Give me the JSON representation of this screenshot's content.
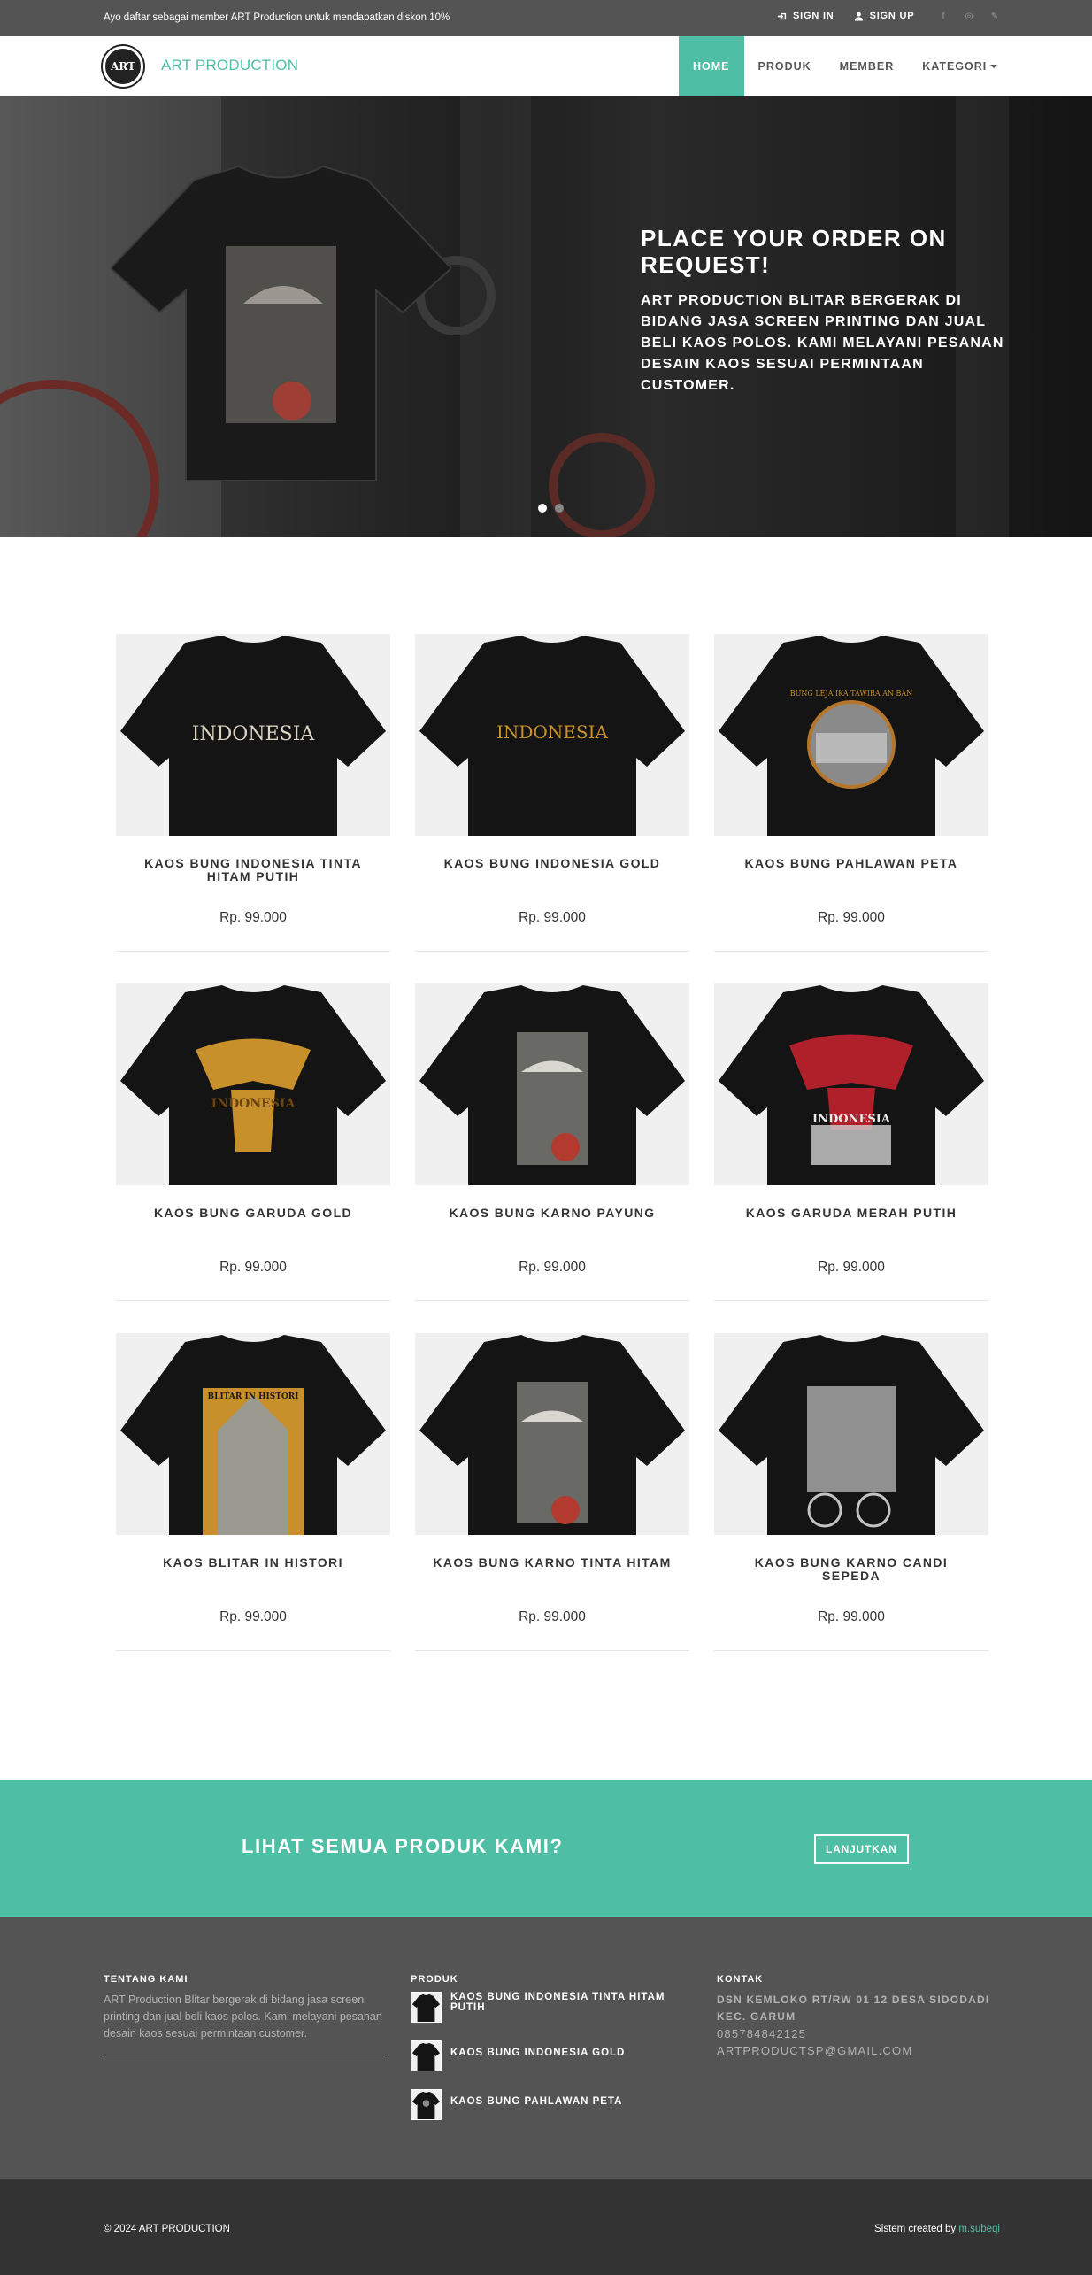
{
  "topbar": {
    "promo": "Ayo daftar sebagai member ART Production untuk mendapatkan diskon 10%",
    "sign_in": "SIGN IN",
    "sign_up": "SIGN UP",
    "social_icons": [
      "facebook-icon",
      "instagram-icon",
      "link-icon"
    ]
  },
  "navbar": {
    "logo_text": "ART",
    "brand": "ART PRODUCTION",
    "menu": [
      {
        "label": "HOME",
        "active": true
      },
      {
        "label": "PRODUK",
        "active": false
      },
      {
        "label": "MEMBER",
        "active": false
      },
      {
        "label": "KATEGORI",
        "active": false
      }
    ]
  },
  "hero": {
    "title": "PLACE YOUR ORDER ON REQUEST!",
    "text": "ART PRODUCTION BLITAR BERGERAK DI BIDANG JASA SCREEN PRINTING DAN JUAL BELI KAOS POLOS. KAMI MELAYANI PESANAN DESAIN KAOS SESUAI PERMINTAAN CUSTOMER.",
    "slide_count": 2,
    "active_slide": 1
  },
  "products": [
    {
      "name": "KAOS BUNG INDONESIA TINTA HITAM PUTIH",
      "price": "Rp. 99.000",
      "print": "INDONESIA",
      "print_color": "#d9d2c0"
    },
    {
      "name": "KAOS BUNG INDONESIA GOLD",
      "price": "Rp. 99.000",
      "print": "INDONESIA",
      "print_color": "#c8902a"
    },
    {
      "name": "KAOS BUNG PAHLAWAN PETA",
      "price": "Rp. 99.000",
      "print": "",
      "print_color": "#b0b0b0"
    },
    {
      "name": "KAOS BUNG GARUDA GOLD",
      "price": "Rp. 99.000",
      "print": "INDONESIA",
      "print_color": "#c8902a"
    },
    {
      "name": "KAOS BUNG KARNO PAYUNG",
      "price": "Rp. 99.000",
      "print": "",
      "print_color": "#bdbdb5"
    },
    {
      "name": "KAOS GARUDA MERAH PUTIH",
      "price": "Rp. 99.000",
      "print": "INDONESIA",
      "print_color": "#b0202a"
    },
    {
      "name": "KAOS BLITAR IN HISTORI",
      "price": "Rp. 99.000",
      "print": "BLITAR IN HISTORI",
      "print_color": "#c8902a"
    },
    {
      "name": "KAOS BUNG KARNO TINTA HITAM",
      "price": "Rp. 99.000",
      "print": "",
      "print_color": "#bdbdb5"
    },
    {
      "name": "KAOS BUNG KARNO CANDI SEPEDA",
      "price": "Rp. 99.000",
      "print": "",
      "print_color": "#c4c4c4"
    }
  ],
  "cta": {
    "text": "LIHAT SEMUA PRODUK KAMI?",
    "button": "LANJUTKAN"
  },
  "footer": {
    "about_title": "TENTANG KAMI",
    "about_text": "ART Production Blitar bergerak di bidang jasa screen printing dan jual beli kaos polos. Kami melayani pesanan desain kaos sesuai permintaan customer.",
    "products_title": "PRODUK",
    "products": [
      "KAOS BUNG INDONESIA TINTA HITAM PUTIH",
      "KAOS BUNG INDONESIA GOLD",
      "KAOS BUNG PAHLAWAN PETA"
    ],
    "contact_title": "KONTAK",
    "address": "DSN KEMLOKO RT/RW 01 12 DESA SIDODADI KEC. GARUM",
    "phone": "085784842125",
    "email": "ARTPRODUCTSP@GMAIL.COM"
  },
  "bottom": {
    "copyright": "© 2024 ART PRODUCTION",
    "credit_prefix": "Sistem created by ",
    "credit_name": "m.subeqi"
  },
  "colors": {
    "accent": "#4ebfa5",
    "topbar": "#545454",
    "footer": "#545454",
    "bottom": "#333333"
  }
}
